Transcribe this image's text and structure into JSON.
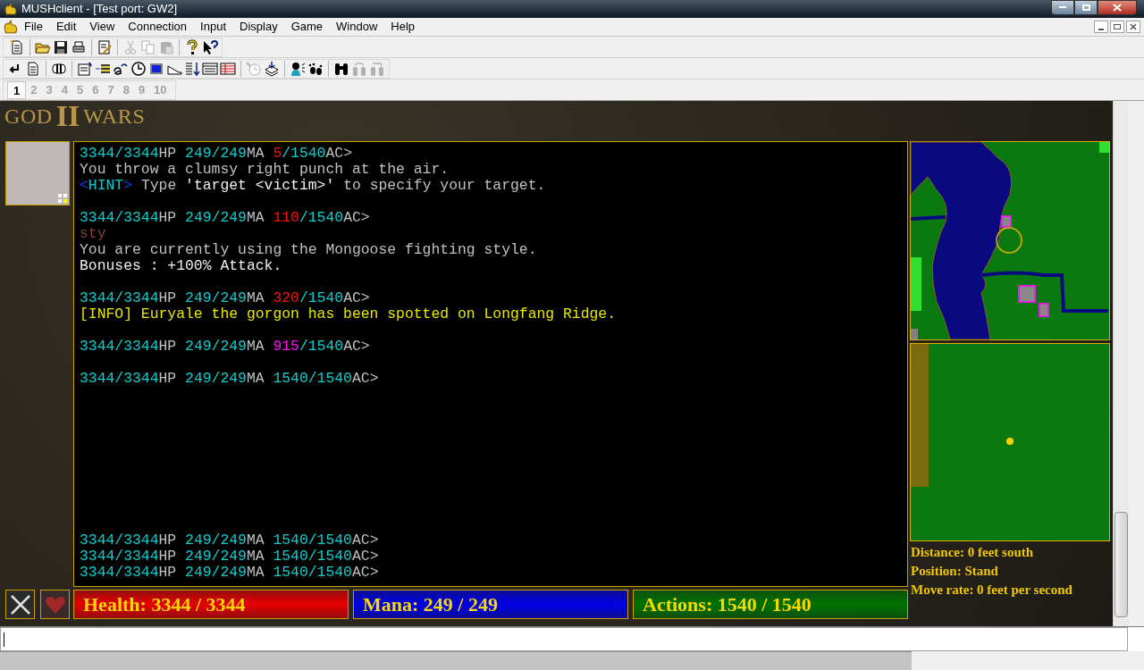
{
  "window": {
    "title": "MUSHclient - [Test port: GW2]"
  },
  "menu": [
    "File",
    "Edit",
    "View",
    "Connection",
    "Input",
    "Display",
    "Game",
    "Window",
    "Help"
  ],
  "world_tabs": [
    {
      "label": "1",
      "selected": true
    },
    {
      "label": "2",
      "selected": false
    },
    {
      "label": "3",
      "selected": false
    },
    {
      "label": "4",
      "selected": false
    },
    {
      "label": "5",
      "selected": false
    },
    {
      "label": "6",
      "selected": false
    },
    {
      "label": "7",
      "selected": false
    },
    {
      "label": "8",
      "selected": false
    },
    {
      "label": "9",
      "selected": false
    },
    {
      "label": "10",
      "selected": false
    }
  ],
  "logo": {
    "left": "GOD",
    "middle": "II",
    "right": "WARS"
  },
  "output": {
    "blocks": [
      [
        [
          {
            "text": "3344/3344",
            "color": "#11cccc"
          },
          {
            "text": "HP ",
            "color": "#c0c0c0"
          },
          {
            "text": "249/249",
            "color": "#11cccc"
          },
          {
            "text": "MA ",
            "color": "#c0c0c0"
          },
          {
            "text": "5",
            "color": "#ff1010"
          },
          {
            "text": "/1540",
            "color": "#11cccc"
          },
          {
            "text": "AC>",
            "color": "#c0c0c0"
          }
        ],
        [
          {
            "text": "You throw a clumsy right punch at the air.",
            "color": "#c0c0c0"
          }
        ],
        [
          {
            "text": "<",
            "color": "#1a3cff"
          },
          {
            "text": "HINT",
            "color": "#11cccc"
          },
          {
            "text": ">",
            "color": "#1a3cff"
          },
          {
            "text": " Type ",
            "color": "#c0c0c0"
          },
          {
            "text": "'target <victim>'",
            "color": "#f0f0f0"
          },
          {
            "text": " to specify your target.",
            "color": "#c0c0c0"
          }
        ]
      ],
      [
        [
          {
            "text": "3344/3344",
            "color": "#11cccc"
          },
          {
            "text": "HP ",
            "color": "#c0c0c0"
          },
          {
            "text": "249/249",
            "color": "#11cccc"
          },
          {
            "text": "MA ",
            "color": "#c0c0c0"
          },
          {
            "text": "110",
            "color": "#ff1010"
          },
          {
            "text": "/1540",
            "color": "#11cccc"
          },
          {
            "text": "AC>",
            "color": "#c0c0c0"
          }
        ],
        [
          {
            "text": "sty",
            "color": "#804040"
          }
        ],
        [
          {
            "text": "You are currently using the Mongoose fighting style.",
            "color": "#c0c0c0"
          }
        ],
        [
          {
            "text": "Bonuses : +100% Attack.",
            "color": "#f0f0f0"
          }
        ]
      ],
      [
        [
          {
            "text": "3344/3344",
            "color": "#11cccc"
          },
          {
            "text": "HP ",
            "color": "#c0c0c0"
          },
          {
            "text": "249/249",
            "color": "#11cccc"
          },
          {
            "text": "MA ",
            "color": "#c0c0c0"
          },
          {
            "text": "320",
            "color": "#ff1010"
          },
          {
            "text": "/1540",
            "color": "#11cccc"
          },
          {
            "text": "AC>",
            "color": "#c0c0c0"
          }
        ],
        [
          {
            "text": "[INFO] Euryale the gorgon has been spotted on Longfang Ridge.",
            "color": "#e8e800"
          }
        ]
      ],
      [
        [
          {
            "text": "3344/3344",
            "color": "#11cccc"
          },
          {
            "text": "HP ",
            "color": "#c0c0c0"
          },
          {
            "text": "249/249",
            "color": "#11cccc"
          },
          {
            "text": "MA ",
            "color": "#c0c0c0"
          },
          {
            "text": "915",
            "color": "#ff10ff"
          },
          {
            "text": "/1540",
            "color": "#11cccc"
          },
          {
            "text": "AC>",
            "color": "#c0c0c0"
          }
        ]
      ],
      [
        [
          {
            "text": "3344/3344",
            "color": "#11cccc"
          },
          {
            "text": "HP ",
            "color": "#c0c0c0"
          },
          {
            "text": "249/249",
            "color": "#11cccc"
          },
          {
            "text": "MA ",
            "color": "#c0c0c0"
          },
          {
            "text": "1540/1540",
            "color": "#11cccc"
          },
          {
            "text": "AC>",
            "color": "#c0c0c0"
          }
        ]
      ]
    ],
    "bottom_lines": [
      [
        {
          "text": "3344/3344",
          "color": "#11cccc"
        },
        {
          "text": "HP ",
          "color": "#c0c0c0"
        },
        {
          "text": "249/249",
          "color": "#11cccc"
        },
        {
          "text": "MA ",
          "color": "#c0c0c0"
        },
        {
          "text": "1540/1540",
          "color": "#11cccc"
        },
        {
          "text": "AC>",
          "color": "#c0c0c0"
        }
      ],
      [
        {
          "text": "3344/3344",
          "color": "#11cccc"
        },
        {
          "text": "HP ",
          "color": "#c0c0c0"
        },
        {
          "text": "249/249",
          "color": "#11cccc"
        },
        {
          "text": "MA ",
          "color": "#c0c0c0"
        },
        {
          "text": "1540/1540",
          "color": "#11cccc"
        },
        {
          "text": "AC>",
          "color": "#c0c0c0"
        }
      ],
      [
        {
          "text": "3344/3344",
          "color": "#11cccc"
        },
        {
          "text": "HP ",
          "color": "#c0c0c0"
        },
        {
          "text": "249/249",
          "color": "#11cccc"
        },
        {
          "text": "MA ",
          "color": "#c0c0c0"
        },
        {
          "text": "1540/1540",
          "color": "#11cccc"
        },
        {
          "text": "AC>",
          "color": "#c0c0c0"
        }
      ]
    ]
  },
  "status": [
    "Distance: 0 feet south",
    "Position: Stand",
    "Move rate: 0 feet per second"
  ],
  "bars": [
    {
      "label": "Health: 3344 / 3344",
      "color": "#e00000",
      "level": 1
    },
    {
      "label": "Mana: 249 / 249",
      "color": "#0000e0",
      "level": 1
    },
    {
      "label": "Actions: 1540 / 1540",
      "color": "#007000",
      "level": 1
    }
  ]
}
